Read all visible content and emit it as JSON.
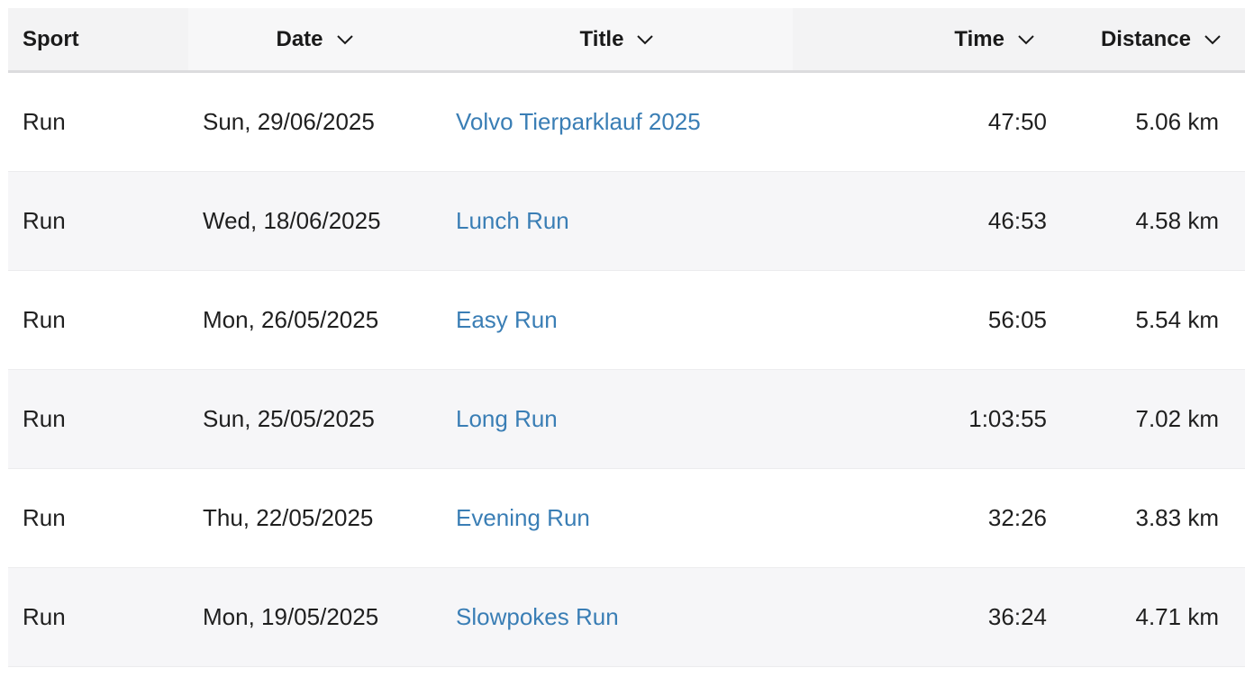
{
  "table": {
    "headers": {
      "sport": "Sport",
      "date": "Date",
      "title": "Title",
      "time": "Time",
      "distance": "Distance"
    },
    "rows": [
      {
        "sport": "Run",
        "date": "Sun, 29/06/2025",
        "title": "Volvo Tierparklauf 2025",
        "time": "47:50",
        "distance": "5.06 km"
      },
      {
        "sport": "Run",
        "date": "Wed, 18/06/2025",
        "title": "Lunch Run",
        "time": "46:53",
        "distance": "4.58 km"
      },
      {
        "sport": "Run",
        "date": "Mon, 26/05/2025",
        "title": "Easy Run",
        "time": "56:05",
        "distance": "5.54 km"
      },
      {
        "sport": "Run",
        "date": "Sun, 25/05/2025",
        "title": "Long Run",
        "time": "1:03:55",
        "distance": "7.02 km"
      },
      {
        "sport": "Run",
        "date": "Thu, 22/05/2025",
        "title": "Evening Run",
        "time": "32:26",
        "distance": "3.83 km"
      },
      {
        "sport": "Run",
        "date": "Mon, 19/05/2025",
        "title": "Slowpokes Run",
        "time": "36:24",
        "distance": "4.71 km"
      }
    ]
  },
  "icons": {
    "sort": "chevron-down-icon"
  },
  "colors": {
    "link": "#3a7eb5",
    "header_bg": "#f3f3f4",
    "stripe_bg": "#f6f6f8"
  }
}
